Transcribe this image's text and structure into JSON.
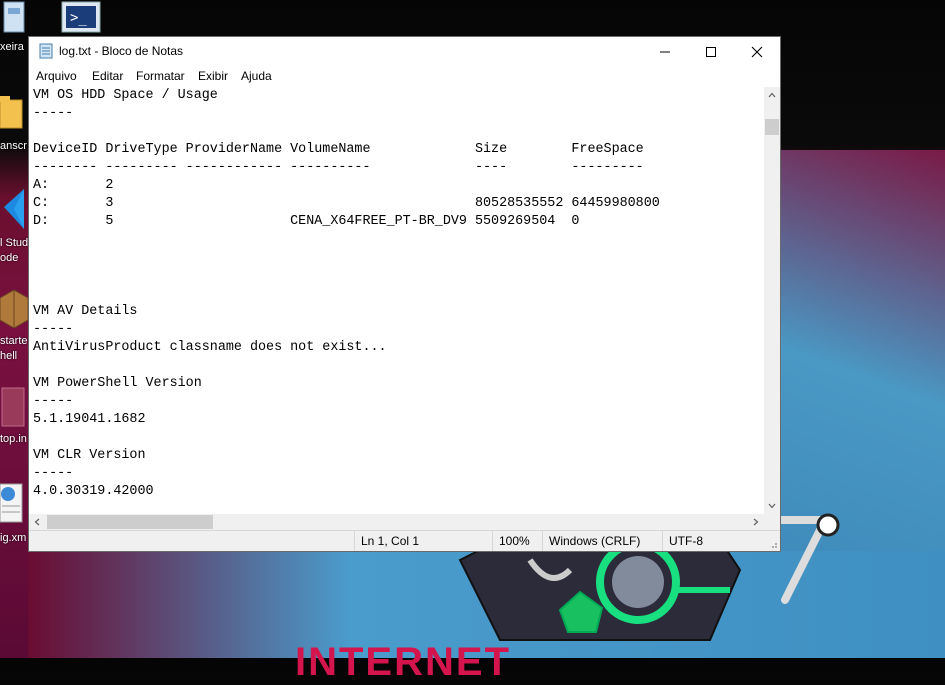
{
  "desktop": {
    "icons": [
      {
        "label": "xeira",
        "icon": "recycle-bin-icon"
      },
      {
        "label": "anscr",
        "icon": "folder-icon"
      },
      {
        "label": "l Stud",
        "label2": "ode",
        "icon": "vscode-icon"
      },
      {
        "label": "starte",
        "label2": "hell",
        "icon": "package-icon"
      },
      {
        "label": "top.in",
        "icon": "settings-file-icon"
      },
      {
        "label": "ig.xm",
        "icon": "xml-file-icon"
      }
    ],
    "powershell_icon": "powershell-icon",
    "banner_text": "INTERNET"
  },
  "window": {
    "title": "log.txt - Bloco de Notas",
    "icon": "notepad-icon",
    "controls": {
      "minimize": "minimize-icon",
      "maximize": "maximize-icon",
      "close": "close-icon"
    },
    "menu": [
      "Arquivo",
      "Editar",
      "Formatar",
      "Exibir",
      "Ajuda"
    ],
    "content_lines": [
      "VM OS HDD Space / Usage",
      "-----",
      "",
      "DeviceID DriveType ProviderName VolumeName             Size        FreeSpace",
      "-------- --------- ------------ ----------             ----        ---------",
      "A:       2",
      "C:       3                                             80528535552 64459980800",
      "D:       5                      CENA_X64FREE_PT-BR_DV9 5509269504  0",
      "",
      "",
      "",
      "",
      "VM AV Details",
      "-----",
      "AntiVirusProduct classname does not exist...",
      "",
      "VM PowerShell Version",
      "-----",
      "5.1.19041.1682",
      "",
      "VM CLR Version",
      "-----",
      "4.0.30319.42000"
    ],
    "status": {
      "position": "Ln 1, Col 1",
      "zoom": "100%",
      "line_ending": "Windows (CRLF)",
      "encoding": "UTF-8"
    }
  }
}
